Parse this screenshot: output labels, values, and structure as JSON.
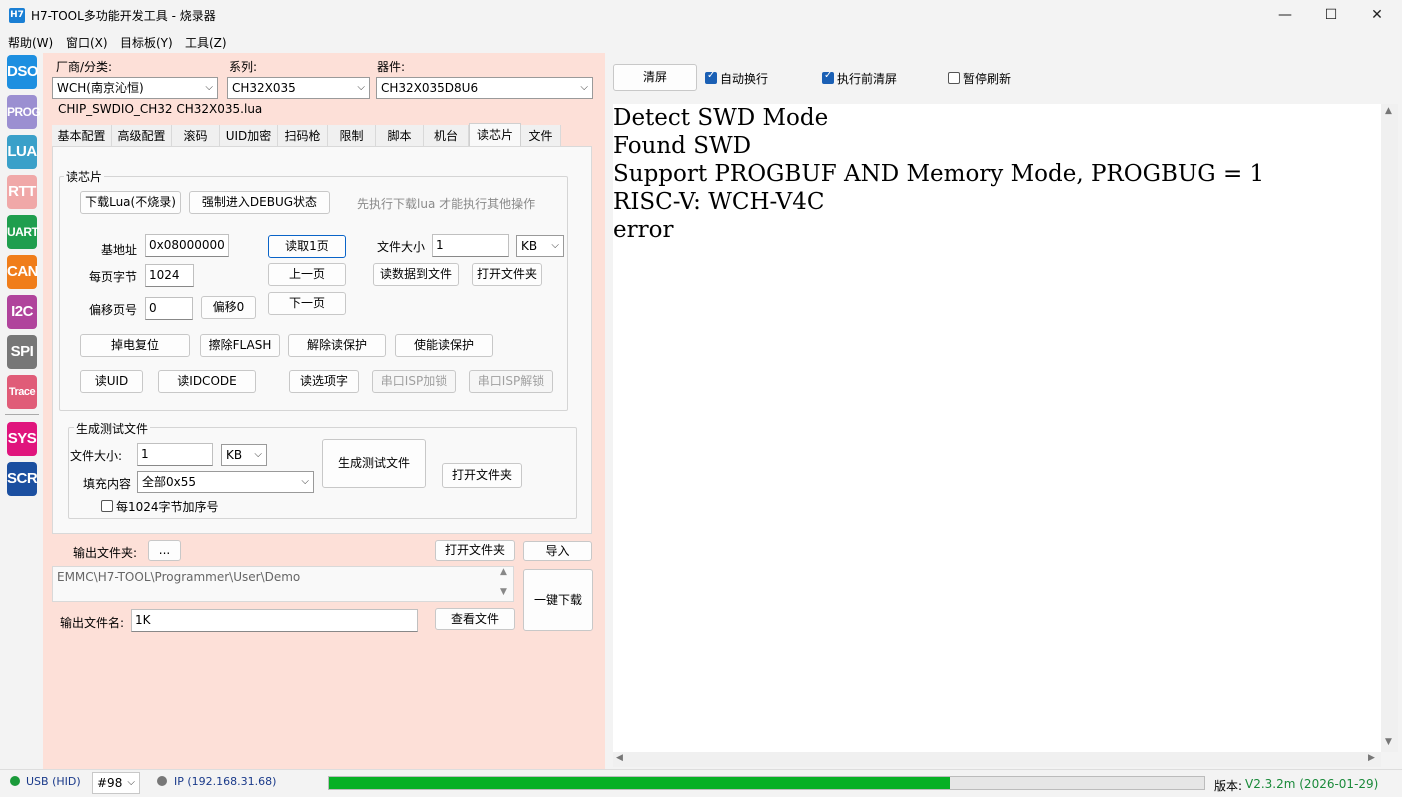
{
  "window": {
    "app_icon": "H7",
    "title": "H7-TOOL多功能开发工具 - 烧录器",
    "min_icon": "—",
    "max_icon": "☐",
    "close_icon": "✕"
  },
  "menu": [
    "帮助(W)",
    "窗口(X)",
    "目标板(Y)",
    "工具(Z)"
  ],
  "toolbar": [
    {
      "label": "DSO",
      "color": "#1d8fe0"
    },
    {
      "label": "PROG",
      "color": "#9b8fd1"
    },
    {
      "label": "LUA",
      "color": "#3aa0c9"
    },
    {
      "label": "RTT",
      "color": "#f0a8a8"
    },
    {
      "label": "UART",
      "color": "#1f9e4e"
    },
    {
      "label": "CAN",
      "color": "#f07d1a"
    },
    {
      "label": "I2C",
      "color": "#b0449c"
    },
    {
      "label": "SPI",
      "color": "#777777"
    },
    {
      "label": "Trace",
      "color": "#e05c78"
    },
    {
      "label": "SYS",
      "color": "#e0157d"
    },
    {
      "label": "SCR",
      "color": "#1b4fa0"
    }
  ],
  "selectors": {
    "vendor_label": "厂商/分类:",
    "vendor_value": "WCH(南京沁恒)",
    "series_label": "系列:",
    "series_value": "CH32X035",
    "device_label": "器件:",
    "device_value": "CH32X035D8U6",
    "script_path": "CHIP_SWDIO_CH32  CH32X035.lua"
  },
  "tabs": [
    "基本配置",
    "高级配置",
    "滚码",
    "UID加密",
    "扫码枪",
    "限制",
    "脚本",
    "机台",
    "读芯片",
    "文件"
  ],
  "active_tab": "读芯片",
  "read_chip": {
    "group_title": "读芯片",
    "download_lua": "下载Lua(不烧录)",
    "force_debug": "强制进入DEBUG状态",
    "hint": "先执行下载lua 才能执行其他操作",
    "base_addr_label": "基地址",
    "base_addr_value": "0x08000000",
    "read_page": "读取1页",
    "file_size_label": "文件大小",
    "file_size_value": "1",
    "file_size_unit": "KB",
    "page_bytes_label": "每页字节",
    "page_bytes_value": "1024",
    "prev_page": "上一页",
    "read_to_file": "读数据到文件",
    "open_folder": "打开文件夹",
    "offset_label": "偏移页号",
    "offset_value": "0",
    "offset_btn": "偏移0",
    "next_page": "下一页",
    "power_reset": "掉电复位",
    "erase_flash": "擦除FLASH",
    "unlock_read": "解除读保护",
    "enable_read": "使能读保护",
    "read_uid": "读UID",
    "read_idcode": "读IDCODE",
    "read_option": "读选项字",
    "isp_lock": "串口ISP加锁",
    "isp_unlock": "串口ISP解锁"
  },
  "gen_test": {
    "group_title": "生成测试文件",
    "size_label": "文件大小:",
    "size_value": "1",
    "size_unit": "KB",
    "generate": "生成测试文件",
    "fill_label": "填充内容",
    "fill_value": "全部0x55",
    "open_folder": "打开文件夹",
    "seq_label": "每1024字节加序号"
  },
  "output": {
    "folder_label": "输出文件夹:",
    "browse": "...",
    "open_folder": "打开文件夹",
    "import": "导入",
    "folder_path": "EMMC\\H7-TOOL\\Programmer\\User\\Demo",
    "one_click": "一键下载",
    "filename_label": "输出文件名:",
    "filename_value": "1K",
    "view_file": "查看文件"
  },
  "console_bar": {
    "clear": "清屏",
    "auto_wrap": "自动换行",
    "clear_before": "执行前清屏",
    "pause": "暂停刷新"
  },
  "console_lines": "Detect SWD Mode\nFound SWD\nSupport PROGBUF AND Memory Mode, PROGBUG = 1\nRISC-V: WCH-V4C\nerror",
  "status": {
    "usb": "USB (HID)",
    "port": "#98",
    "ip": "IP (192.168.31.68)",
    "progress": 0.71,
    "version_label": "版本:",
    "version_value": "V2.3.2m (2026-01-29)"
  }
}
